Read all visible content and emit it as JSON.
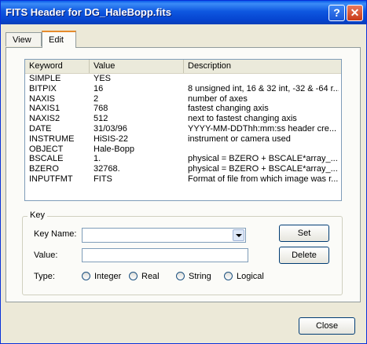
{
  "window": {
    "title": "FITS Header for DG_HaleBopp.fits"
  },
  "tabs": [
    {
      "label": "View"
    },
    {
      "label": "Edit"
    }
  ],
  "table": {
    "columns": [
      "Keyword",
      "Value",
      "Description"
    ],
    "rows": [
      [
        "SIMPLE",
        "YES",
        ""
      ],
      [
        "BITPIX",
        "16",
        "8 unsigned int, 16 & 32 int, -32 & -64 r..."
      ],
      [
        "NAXIS",
        "2",
        "number of axes"
      ],
      [
        "NAXIS1",
        "768",
        "fastest changing axis"
      ],
      [
        "NAXIS2",
        "512",
        "next to fastest changing axis"
      ],
      [
        "DATE",
        "31/03/96",
        "YYYY-MM-DDThh:mm:ss header cre..."
      ],
      [
        "INSTRUME",
        "HiSIS-22",
        "instrument or camera used"
      ],
      [
        "OBJECT",
        "Hale-Bopp",
        ""
      ],
      [
        "BSCALE",
        "1.",
        "physical = BZERO + BSCALE*array_..."
      ],
      [
        "BZERO",
        "32768.",
        "physical = BZERO + BSCALE*array_..."
      ],
      [
        "INPUTFMT",
        "FITS",
        "Format of file from which image was r..."
      ]
    ]
  },
  "key_group": {
    "title": "Key",
    "key_name_label": "Key Name:",
    "key_name_value": "",
    "value_label": "Value:",
    "value_value": "",
    "type_label": "Type:",
    "types": [
      "Integer",
      "Real",
      "String",
      "Logical"
    ],
    "set_label": "Set",
    "delete_label": "Delete"
  },
  "footer": {
    "close_label": "Close"
  }
}
